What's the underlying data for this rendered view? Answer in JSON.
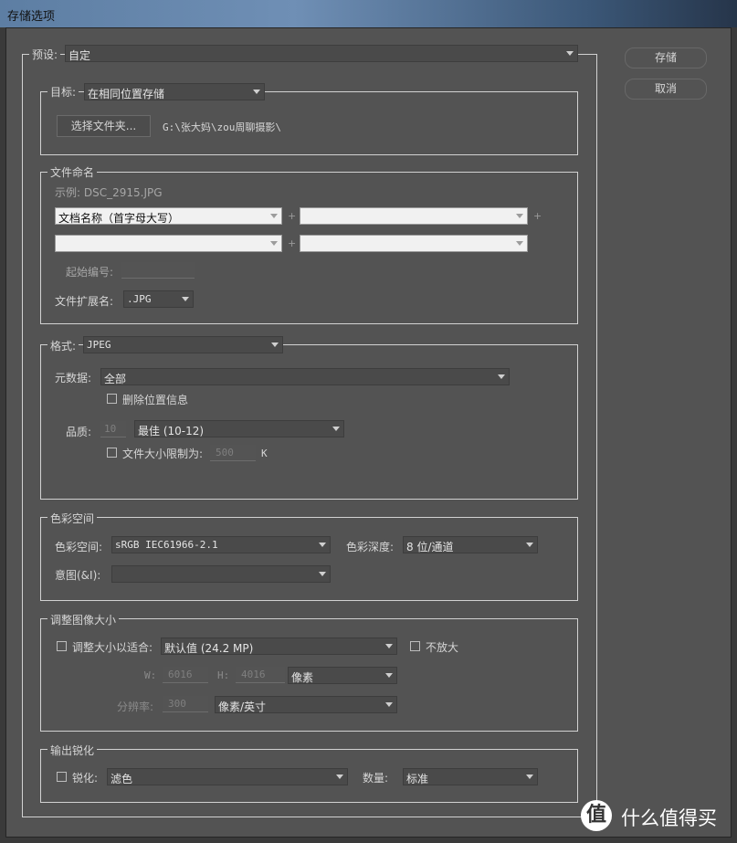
{
  "window": {
    "title": "存储选项"
  },
  "preset": {
    "label": "预设:",
    "value": "自定"
  },
  "buttons": {
    "save": "存储",
    "cancel": "取消"
  },
  "destination": {
    "legend": "目标:",
    "value": "在相同位置存储",
    "choose_folder": "选择文件夹...",
    "path": "G:\\张大妈\\zou周聊摄影\\"
  },
  "naming": {
    "legend": "文件命名",
    "example": "示例: DSC_2915.JPG",
    "field1": "文档名称（首字母大写）",
    "field2": "",
    "field3": "",
    "field4": "",
    "plus": "+",
    "start_label": "起始编号:",
    "ext_label": "文件扩展名:",
    "ext_value": ".JPG"
  },
  "format": {
    "legend": "格式:",
    "value": "JPEG",
    "metadata_label": "元数据:",
    "metadata_value": "全部",
    "remove_location": "删除位置信息",
    "quality_label": "品质:",
    "quality_value": "10",
    "quality_select": "最佳  (10-12)",
    "limit_label": "文件大小限制为:",
    "limit_value": "500",
    "limit_unit": "K"
  },
  "color": {
    "legend": "色彩空间",
    "space_label": "色彩空间:",
    "space_value": "sRGB IEC61966-2.1",
    "depth_label": "色彩深度:",
    "depth_value": "8 位/通道",
    "intent_label": "意图(&I):",
    "intent_value": ""
  },
  "resize": {
    "legend": "调整图像大小",
    "fit_label": "调整大小以适合:",
    "fit_value": "默认值 (24.2 MP)",
    "no_enlarge": "不放大",
    "w_label": "W:",
    "w_value": "6016",
    "h_label": "H:",
    "h_value": "4016",
    "unit_value": "像素",
    "res_label": "分辨率:",
    "res_value": "300",
    "res_unit": "像素/英寸"
  },
  "sharpen": {
    "legend": "输出锐化",
    "sharpen_label": "锐化:",
    "sharpen_value": "滤色",
    "amount_label": "数量:",
    "amount_value": "标准"
  },
  "watermark": {
    "logo": "值",
    "text": "什么值得买"
  }
}
